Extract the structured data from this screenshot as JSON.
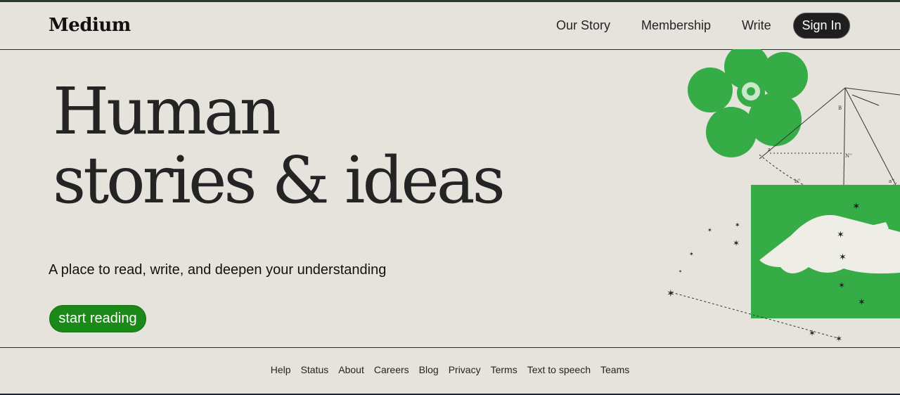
{
  "brand": {
    "name": "Medium",
    "accent": "#1a8917",
    "illustration_green": "#36ac47"
  },
  "nav": {
    "links": [
      "Our Story",
      "Membership",
      "Write"
    ],
    "sign_in": "Sign In"
  },
  "hero": {
    "title_line1": "Human",
    "title_line2": "stories & ideas",
    "subtitle": "A place to read, write, and deepen your understanding",
    "cta": "start reading"
  },
  "illustration": {
    "name": "flower-geometry-hand-illustration",
    "labels": [
      "a",
      "B",
      "N''",
      "E",
      "z",
      "b''",
      "a''"
    ]
  },
  "footer": {
    "links": [
      "Help",
      "Status",
      "About",
      "Careers",
      "Blog",
      "Privacy",
      "Terms",
      "Text to speech",
      "Teams"
    ]
  }
}
